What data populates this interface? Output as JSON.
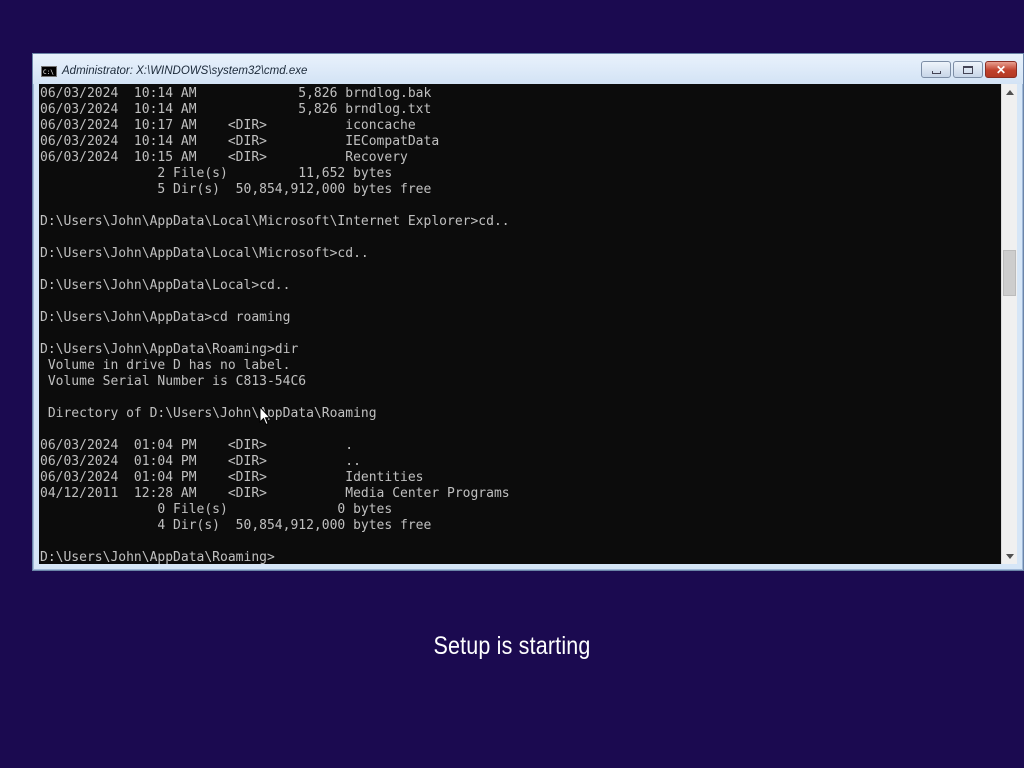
{
  "window": {
    "title": "Administrator: X:\\WINDOWS\\system32\\cmd.exe",
    "icon_text": "C:\\",
    "controls": {
      "minimize": "minimize",
      "maximize": "maximize",
      "close": "✕"
    }
  },
  "console": {
    "lines": [
      "06/03/2024  10:14 AM             5,826 brndlog.bak",
      "06/03/2024  10:14 AM             5,826 brndlog.txt",
      "06/03/2024  10:17 AM    <DIR>          iconcache",
      "06/03/2024  10:14 AM    <DIR>          IECompatData",
      "06/03/2024  10:15 AM    <DIR>          Recovery",
      "               2 File(s)         11,652 bytes",
      "               5 Dir(s)  50,854,912,000 bytes free",
      "",
      "D:\\Users\\John\\AppData\\Local\\Microsoft\\Internet Explorer>cd..",
      "",
      "D:\\Users\\John\\AppData\\Local\\Microsoft>cd..",
      "",
      "D:\\Users\\John\\AppData\\Local>cd..",
      "",
      "D:\\Users\\John\\AppData>cd roaming",
      "",
      "D:\\Users\\John\\AppData\\Roaming>dir",
      " Volume in drive D has no label.",
      " Volume Serial Number is C813-54C6",
      "",
      " Directory of D:\\Users\\John\\AppData\\Roaming",
      "",
      "06/03/2024  01:04 PM    <DIR>          .",
      "06/03/2024  01:04 PM    <DIR>          ..",
      "06/03/2024  01:04 PM    <DIR>          Identities",
      "04/12/2011  12:28 AM    <DIR>          Media Center Programs",
      "               0 File(s)              0 bytes",
      "               4 Dir(s)  50,854,912,000 bytes free",
      "",
      "D:\\Users\\John\\AppData\\Roaming>"
    ]
  },
  "setup": {
    "status_text": "Setup is starting"
  },
  "colors": {
    "background": "#1b0a50",
    "console_background": "#0c0c0c",
    "console_text": "#c0c0c0"
  }
}
